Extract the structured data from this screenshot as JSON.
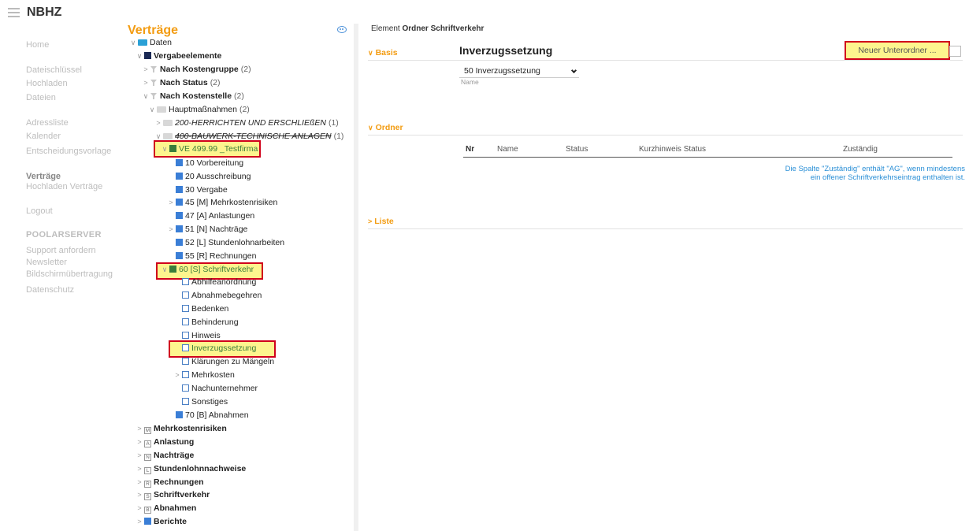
{
  "app": {
    "title": "NBHZ"
  },
  "leftnav": {
    "items": [
      {
        "label": "Home",
        "style": "normal"
      },
      {
        "label": "Dateischlüssel",
        "style": "normal"
      },
      {
        "label": "Hochladen",
        "style": "normal"
      },
      {
        "label": "Dateien",
        "style": "normal"
      },
      {
        "label": "Adressliste",
        "style": "normal"
      },
      {
        "label": "Kalender",
        "style": "normal"
      },
      {
        "label": "Entscheidungsvorlage",
        "style": "normal"
      },
      {
        "label": "Verträge",
        "style": "bold"
      },
      {
        "label": "Hochladen Verträge",
        "style": "normal"
      },
      {
        "label": "Logout",
        "style": "normal"
      },
      {
        "label": "POOLARSERVER",
        "style": "heading"
      },
      {
        "label": "Support anfordern",
        "style": "normal"
      },
      {
        "label": "Newsletter",
        "style": "normal"
      },
      {
        "label": "Bildschirmübertragung",
        "style": "normal"
      },
      {
        "label": "Datenschutz",
        "style": "normal"
      }
    ]
  },
  "tree": {
    "title": "Verträge",
    "rows": [
      {
        "label": "Daten",
        "count": "",
        "chev": "down",
        "icon": "folder-blue",
        "style": ""
      },
      {
        "label": "Vergabeelemente",
        "count": "",
        "chev": "down",
        "icon": "sq-navy",
        "style": "bold"
      },
      {
        "label": "Nach Kostengruppe",
        "count": "(2)",
        "chev": "right",
        "icon": "filter",
        "style": "bold"
      },
      {
        "label": "Nach Status",
        "count": "(2)",
        "chev": "right",
        "icon": "filter",
        "style": "bold"
      },
      {
        "label": "Nach Kostenstelle",
        "count": "(2)",
        "chev": "down",
        "icon": "filter",
        "style": "bold"
      },
      {
        "label": "Hauptmaßnahmen",
        "count": "(2)",
        "chev": "down",
        "icon": "folder-grey",
        "style": ""
      },
      {
        "label": "200-HERRICHTEN UND ERSCHLIEßEN",
        "count": "(1)",
        "chev": "right",
        "icon": "folder-grey",
        "style": "ital"
      },
      {
        "label": "400-BAUWERK-TECHNISCHE ANLAGEN",
        "count": "(1)",
        "chev": "down",
        "icon": "folder-grey",
        "style": "ital strike"
      },
      {
        "label": "VE 499.99 _Testfirma",
        "count": "",
        "chev": "down",
        "icon": "sq-green",
        "style": "",
        "highlight": true
      },
      {
        "label": "10 Vorbereitung",
        "count": "",
        "chev": "",
        "icon": "sq-blue",
        "style": ""
      },
      {
        "label": "20 Ausschreibung",
        "count": "",
        "chev": "",
        "icon": "sq-blue",
        "style": ""
      },
      {
        "label": "30 Vergabe",
        "count": "",
        "chev": "",
        "icon": "sq-blue",
        "style": ""
      },
      {
        "label": "45 [M] Mehrkostenrisiken",
        "count": "",
        "chev": "right",
        "icon": "sq-blue",
        "style": ""
      },
      {
        "label": "47 [A] Anlastungen",
        "count": "",
        "chev": "",
        "icon": "sq-blue",
        "style": ""
      },
      {
        "label": "51 [N] Nachträge",
        "count": "",
        "chev": "right",
        "icon": "sq-blue",
        "style": ""
      },
      {
        "label": "52 [L] Stundenlohnarbeiten",
        "count": "",
        "chev": "",
        "icon": "sq-blue",
        "style": ""
      },
      {
        "label": "55 [R] Rechnungen",
        "count": "",
        "chev": "",
        "icon": "sq-blue",
        "style": ""
      },
      {
        "label": "60 [S] Schriftverkehr",
        "count": "",
        "chev": "down",
        "icon": "sq-green",
        "style": "",
        "highlight": true
      },
      {
        "label": "Abhilfeanordnung",
        "count": "",
        "chev": "",
        "icon": "sq-outline",
        "style": ""
      },
      {
        "label": "Abnahmebegehren",
        "count": "",
        "chev": "",
        "icon": "sq-outline",
        "style": ""
      },
      {
        "label": "Bedenken",
        "count": "",
        "chev": "",
        "icon": "sq-outline",
        "style": ""
      },
      {
        "label": "Behinderung",
        "count": "",
        "chev": "",
        "icon": "sq-outline",
        "style": ""
      },
      {
        "label": "Hinweis",
        "count": "",
        "chev": "",
        "icon": "sq-outline",
        "style": ""
      },
      {
        "label": "Inverzugssetzung",
        "count": "",
        "chev": "",
        "icon": "sq-outline",
        "style": "",
        "highlight": true
      },
      {
        "label": "Klärungen zu Mängeln",
        "count": "",
        "chev": "",
        "icon": "sq-outline",
        "style": ""
      },
      {
        "label": "Mehrkosten",
        "count": "",
        "chev": "right",
        "icon": "sq-outline",
        "style": ""
      },
      {
        "label": "Nachunternehmer",
        "count": "",
        "chev": "",
        "icon": "sq-outline",
        "style": ""
      },
      {
        "label": "Sonstiges",
        "count": "",
        "chev": "",
        "icon": "sq-outline",
        "style": ""
      },
      {
        "label": "70 [B] Abnahmen",
        "count": "",
        "chev": "",
        "icon": "sq-blue",
        "style": ""
      },
      {
        "label": "Mehrkostenrisiken",
        "count": "",
        "chev": "right",
        "icon": "sq-letter",
        "letter": "M",
        "style": "bold"
      },
      {
        "label": "Anlastung",
        "count": "",
        "chev": "right",
        "icon": "sq-letter",
        "letter": "A",
        "style": "bold"
      },
      {
        "label": "Nachträge",
        "count": "",
        "chev": "right",
        "icon": "sq-letter",
        "letter": "N",
        "style": "bold"
      },
      {
        "label": "Stundenlohnnachweise",
        "count": "",
        "chev": "right",
        "icon": "sq-letter",
        "letter": "L",
        "style": "bold"
      },
      {
        "label": "Rechnungen",
        "count": "",
        "chev": "right",
        "icon": "sq-letter",
        "letter": "R",
        "style": "bold"
      },
      {
        "label": "Schriftverkehr",
        "count": "",
        "chev": "right",
        "icon": "sq-letter",
        "letter": "S",
        "style": "bold"
      },
      {
        "label": "Abnahmen",
        "count": "",
        "chev": "right",
        "icon": "sq-letter",
        "letter": "B",
        "style": "bold"
      },
      {
        "label": "Berichte",
        "count": "",
        "chev": "right",
        "icon": "sq-blue",
        "style": "bold"
      }
    ]
  },
  "main": {
    "breadcrumb_prefix": "Element",
    "breadcrumb_current": "Ordner Schriftverkehr",
    "sections": {
      "basis": "Basis",
      "ordner": "Ordner",
      "liste": "Liste"
    },
    "form_title": "Inverzugssetzung",
    "new_button": "Neuer Unterordner ...",
    "select_value": "50 Inverzugssetzung",
    "select_label": "Name",
    "table_headers": [
      "Nr",
      "Name",
      "Status",
      "Kurzhinweis Status",
      "Zuständig"
    ],
    "hint_line1": "Die Spalte \"Zuständig\" enthält \"AG\", wenn mindestens",
    "hint_line2": "ein offener Schriftverkehrseintrag enthalten ist."
  },
  "colors": {
    "accent": "#f39c12",
    "highlight": "#fdf58e",
    "highlight_border": "#d0021b",
    "link": "#2a8fd6"
  }
}
